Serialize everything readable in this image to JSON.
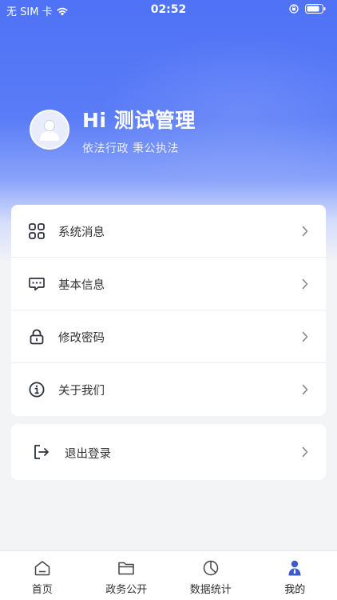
{
  "status_bar": {
    "carrier": "无 SIM 卡",
    "time": "02:52"
  },
  "profile": {
    "greeting": "Hi 测试管理",
    "motto": "依法行政 秉公执法",
    "avatar_icon": "user-avatar-icon"
  },
  "menu": {
    "items": [
      {
        "label": "系统消息",
        "icon": "grid-icon"
      },
      {
        "label": "基本信息",
        "icon": "chat-info-icon"
      },
      {
        "label": "修改密码",
        "icon": "lock-icon"
      },
      {
        "label": "关于我们",
        "icon": "info-icon"
      }
    ],
    "logout": {
      "label": "退出登录",
      "icon": "logout-icon"
    }
  },
  "tab_bar": {
    "tabs": [
      {
        "label": "首页",
        "icon": "home-icon",
        "active": false
      },
      {
        "label": "政务公开",
        "icon": "folder-icon",
        "active": false
      },
      {
        "label": "数据统计",
        "icon": "pie-chart-icon",
        "active": false
      },
      {
        "label": "我的",
        "icon": "person-icon",
        "active": true
      }
    ]
  },
  "colors": {
    "hero_blue": "#4f72f6",
    "accent_active": "#3b5ccc",
    "text": "#333333",
    "icon_dark": "#2f3140"
  }
}
